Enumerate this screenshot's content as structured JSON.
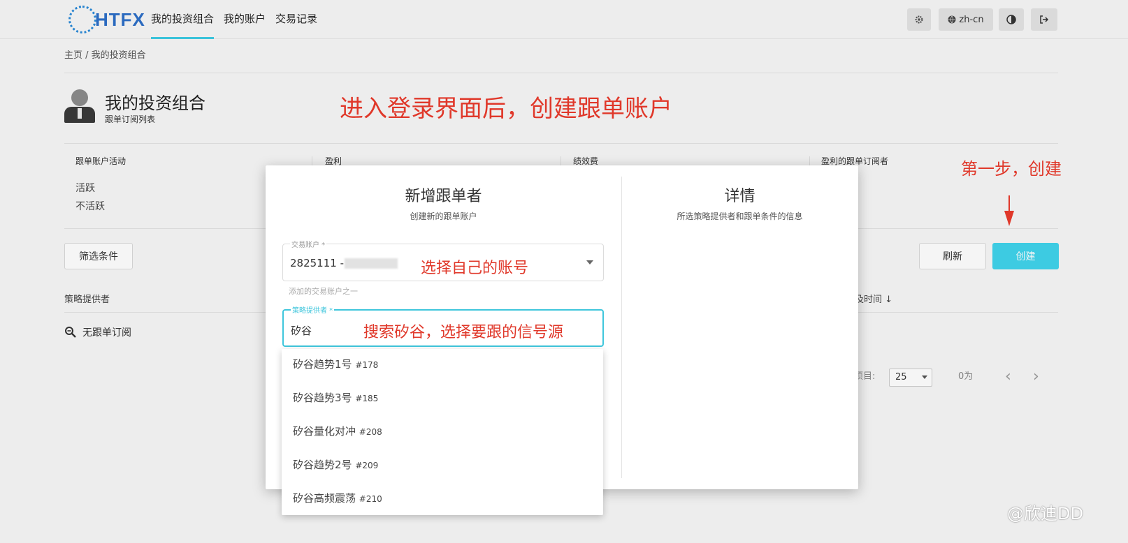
{
  "header": {
    "logo_text": "HTFX",
    "nav": [
      "我的投资组合",
      "我的账户",
      "交易记录"
    ],
    "lang": "zh-cn",
    "settings_icon": "gear-icon",
    "theme_icon": "contrast-icon",
    "logout_icon": "logout-icon",
    "lang_icon": "globe-icon"
  },
  "breadcrumb": "主页 / 我的投资组合",
  "page": {
    "title": "我的投资组合",
    "subtitle": "跟单订阅列表"
  },
  "filters": {
    "col1_label": "跟单账户活动",
    "col1_options": [
      "活跃",
      "不活跃"
    ],
    "col2_label": "盈利",
    "col3_label": "绩效费",
    "col4_label": "盈利的跟单订阅者"
  },
  "buttons": {
    "filter": "筛选条件",
    "refresh": "刷新",
    "create": "创建"
  },
  "table": {
    "col_provider": "策略提供者",
    "col_time": "及时间 ↓",
    "empty": "无跟单订阅"
  },
  "pager": {
    "per_page_label": "项目:",
    "per_page": "25",
    "range": "0为"
  },
  "modal": {
    "title": "新增跟单者",
    "subtitle": "创建新的跟单账户",
    "details_title": "详情",
    "details_subtitle": "所选策略提供者和跟单条件的信息",
    "account_label": "交易账户 *",
    "account_value": "2825111 -",
    "account_help": "添加的交易账户之一",
    "provider_label": "策略提供者 *",
    "provider_value": "矽谷"
  },
  "dropdown": [
    {
      "name": "矽谷趋势1号",
      "num": "#178"
    },
    {
      "name": "矽谷趋势3号",
      "num": "#185"
    },
    {
      "name": "矽谷量化对冲",
      "num": "#208"
    },
    {
      "name": "矽谷趋势2号",
      "num": "#209"
    },
    {
      "name": "矽谷高频震荡",
      "num": "#210"
    }
  ],
  "annotations": {
    "main": "进入登录界面后，创建跟单账户",
    "step1": "第一步，创建",
    "account": "选择自己的账号",
    "search": "搜索矽谷，选择要跟的信号源"
  },
  "watermark": "@欣迪DD",
  "colors": {
    "accent": "#40d4ec",
    "annotation": "#e0382a",
    "logo": "#2d6fc7"
  }
}
